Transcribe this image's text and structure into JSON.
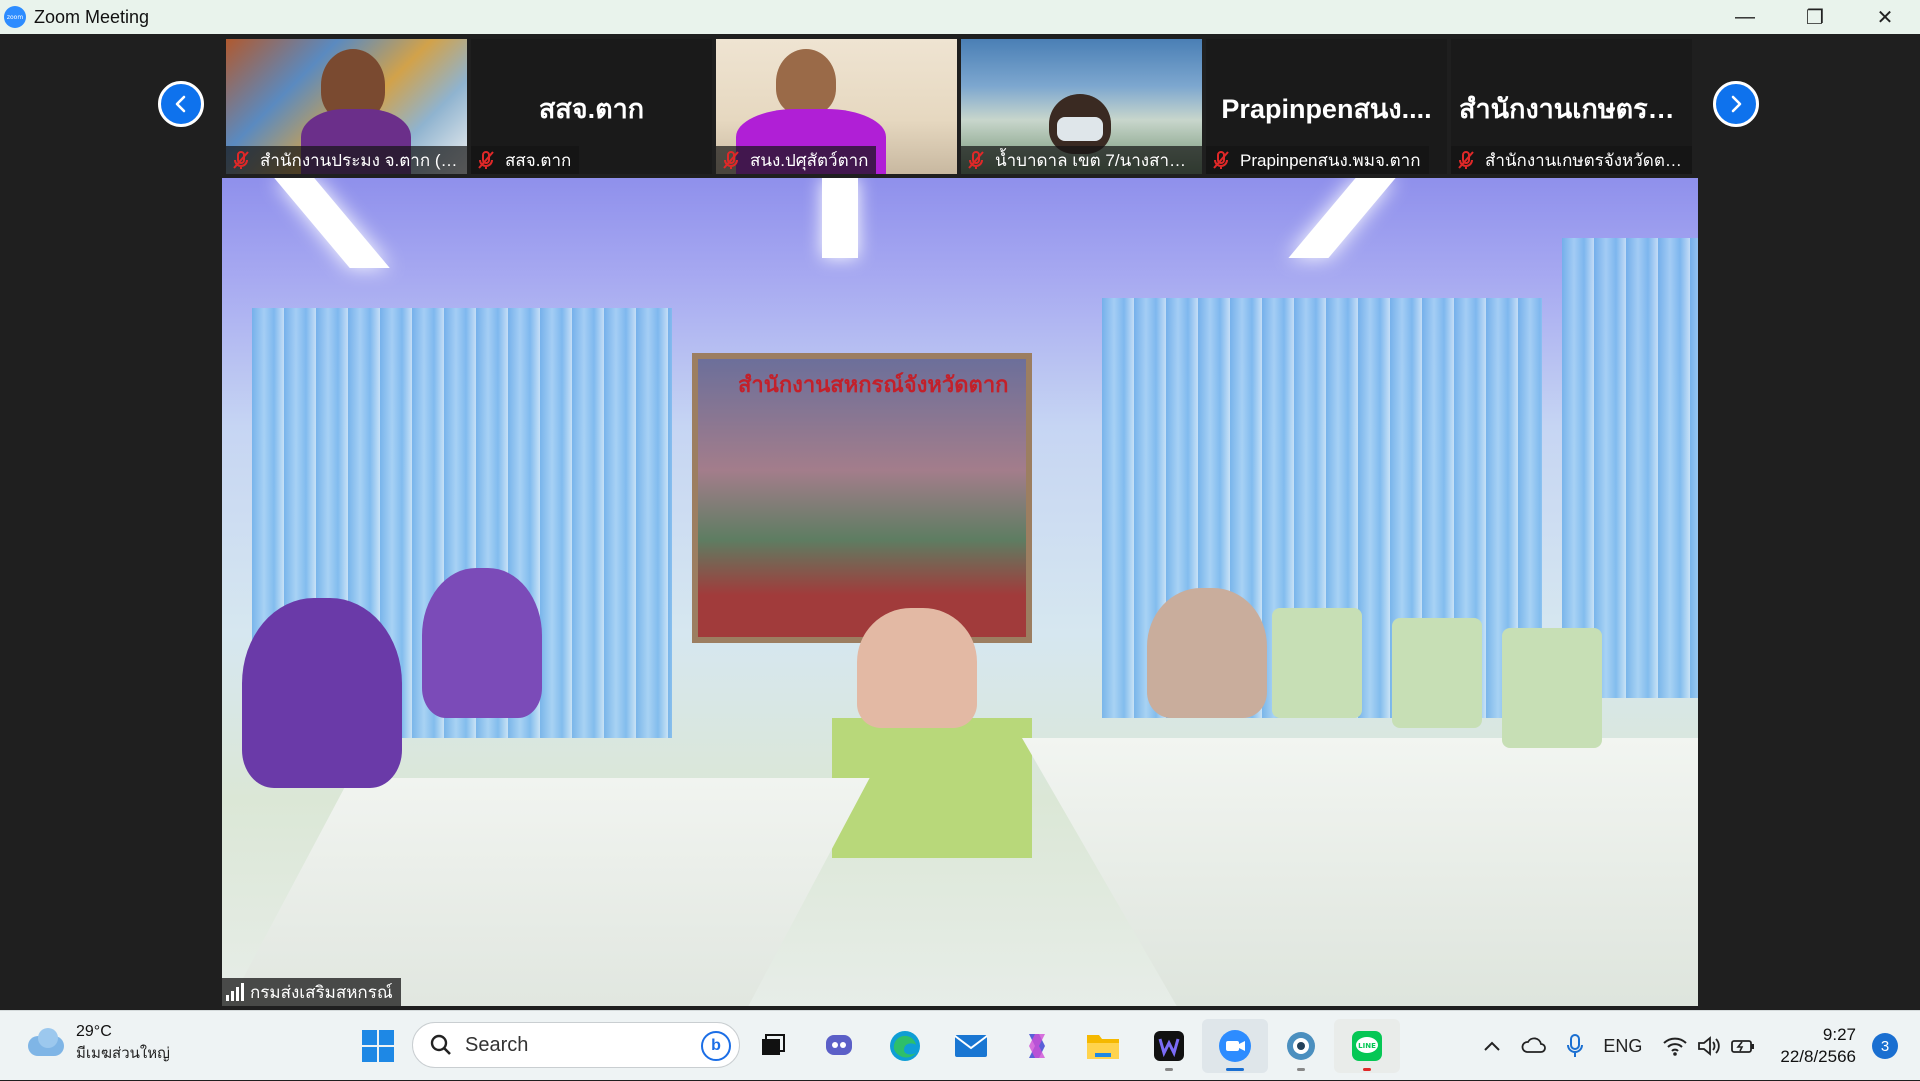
{
  "window": {
    "title": "Zoom Meeting",
    "app_icon_text": "zoom",
    "minimize": "—",
    "restore": "❐",
    "close": "✕"
  },
  "gallery": {
    "prev_icon": "chevron-left-icon",
    "next_icon": "chevron-right-icon",
    "tiles": [
      {
        "label": "สำนักงานประมง จ.ตาก (อ...",
        "has_video": true
      },
      {
        "center_name": "สสจ.ตาก",
        "label": "สสจ.ตาก",
        "has_video": false
      },
      {
        "label": "สนง.ปศุสัตว์ตาก",
        "has_video": true
      },
      {
        "label": "น้ำบาดาล เขต 7/นางสาวนิ...",
        "has_video": true
      },
      {
        "center_name": "Prapinpenสนง....",
        "label": "Prapinpenสนง.พมจ.ตาก",
        "has_video": false
      },
      {
        "center_name": "สำนักงานเกษตรจั...",
        "label": "สำนักงานเกษตรจังหวัดตาก",
        "has_video": false
      }
    ]
  },
  "main_video": {
    "speaker_label": "กรมส่งเสริมสหกรณ์",
    "banner_text": "สำนักงานสหกรณ์จังหวัดตาก"
  },
  "taskbar": {
    "weather": {
      "temp": "29°C",
      "desc": "มีเมฆส่วนใหญ่"
    },
    "search": {
      "placeholder": "Search",
      "bing": "b"
    },
    "apps": [
      "start-icon",
      "task-view-icon",
      "teams-chat-icon",
      "edge-icon",
      "mail-icon",
      "copilot-icon",
      "file-explorer-icon",
      "clipchamp-icon",
      "zoom-icon",
      "webcam-app-icon",
      "line-icon"
    ],
    "tray": {
      "language": "ENG",
      "time": "9:27",
      "date": "22/8/2566",
      "notifications": "3"
    }
  },
  "colors": {
    "zoom_blue": "#0e72ed",
    "titlebar_bg": "#e9f3ec",
    "meeting_bg": "#1f1f1f",
    "mic_muted_red": "#e02828",
    "taskbar_bg": "#eef3f4"
  }
}
